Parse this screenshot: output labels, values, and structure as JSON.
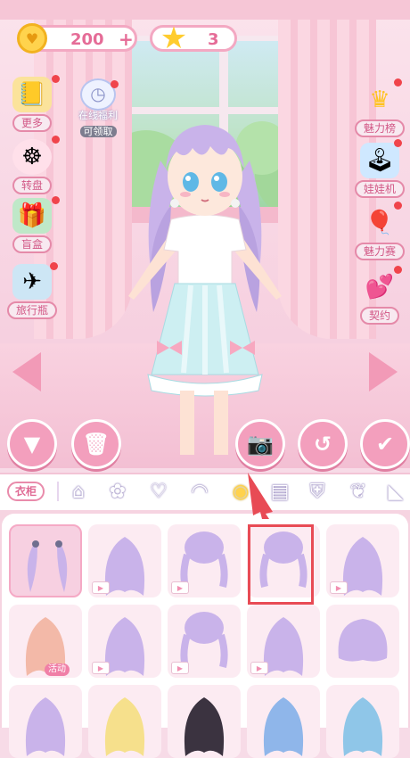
{
  "currency": {
    "coins": "200",
    "coin_plus": "+",
    "stars": "3"
  },
  "left_menu": [
    {
      "label": "更多"
    },
    {
      "label": "转盘"
    },
    {
      "label": "盲盒"
    },
    {
      "label": "旅行瓶"
    }
  ],
  "online_reward": {
    "title": "在线福利",
    "sub": "可领取"
  },
  "right_menu": [
    {
      "label": "魅力榜"
    },
    {
      "label": "娃娃机"
    },
    {
      "label": "魅力赛"
    },
    {
      "label": "契约"
    }
  ],
  "wardrobe_label": "衣柜",
  "categories": [
    {
      "name": "home",
      "glyph": "⌂"
    },
    {
      "name": "paw",
      "glyph": "✿"
    },
    {
      "name": "hearts",
      "glyph": "♡"
    },
    {
      "name": "hair-front",
      "glyph": "◠"
    },
    {
      "name": "hair-back",
      "glyph": "◉"
    },
    {
      "name": "shirt",
      "glyph": "▤"
    },
    {
      "name": "skirt",
      "glyph": "⛨"
    },
    {
      "name": "socks",
      "glyph": "❦"
    },
    {
      "name": "shoes",
      "glyph": "◣"
    }
  ],
  "event_tag": "活动",
  "colors": {
    "accent": "#f39fbd",
    "panel": "#f6d4e1",
    "hair": "#c9b3ea",
    "highlight": "#e84b55"
  },
  "grid_items": [
    {
      "style": "twin-ties",
      "video": false,
      "selected": true
    },
    {
      "style": "long-straight",
      "video": true
    },
    {
      "style": "twin-braids-low",
      "video": true
    },
    {
      "style": "short-braids",
      "video": false,
      "highlighted": true
    },
    {
      "style": "long-twin",
      "video": true
    },
    {
      "style": "wavy-peach",
      "video": false,
      "event": true
    },
    {
      "style": "long-wave",
      "video": true
    },
    {
      "style": "twin-braids-long",
      "video": true
    },
    {
      "style": "long-fine",
      "video": true
    },
    {
      "style": "bob-wavy",
      "video": false
    },
    {
      "style": "purple-curl",
      "video": false
    },
    {
      "style": "blonde",
      "video": false
    },
    {
      "style": "black-long",
      "video": false
    },
    {
      "style": "blue-bun",
      "video": false
    },
    {
      "style": "blue-ponytail",
      "video": false
    }
  ]
}
